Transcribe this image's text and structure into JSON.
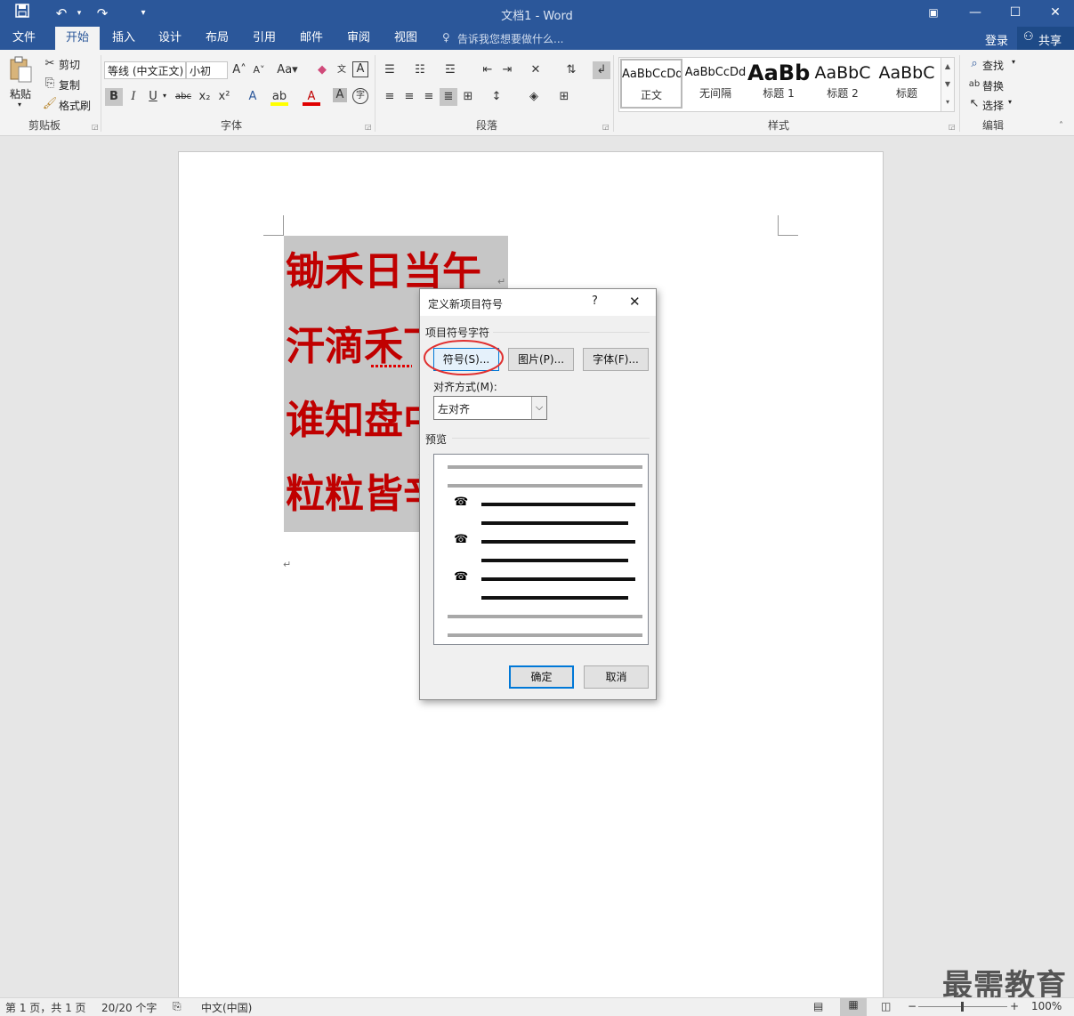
{
  "window": {
    "title": "文档1 - Word"
  },
  "tabs": [
    {
      "label": "文件"
    },
    {
      "label": "开始"
    },
    {
      "label": "插入"
    },
    {
      "label": "设计"
    },
    {
      "label": "布局"
    },
    {
      "label": "引用"
    },
    {
      "label": "邮件"
    },
    {
      "label": "审阅"
    },
    {
      "label": "视图"
    }
  ],
  "tell_me": "告诉我您想要做什么...",
  "account": {
    "login": "登录",
    "share": "共享"
  },
  "clipboard": {
    "paste": "粘贴",
    "cut": "剪切",
    "copy": "复制",
    "format_painter": "格式刷",
    "label": "剪贴板"
  },
  "font": {
    "name": "等线 (中文正文)",
    "size": "小初",
    "label": "字体"
  },
  "paragraph": {
    "label": "段落"
  },
  "styles": {
    "label": "样式",
    "items": [
      {
        "sample": "AaBbCcDd",
        "name": "正文"
      },
      {
        "sample": "AaBbCcDd",
        "name": "无间隔"
      },
      {
        "sample": "AaBb",
        "name": "标题 1"
      },
      {
        "sample": "AaBbC",
        "name": "标题 2"
      },
      {
        "sample": "AaBbC",
        "name": "标题"
      }
    ]
  },
  "editing": {
    "find": "查找",
    "replace": "替换",
    "select": "选择",
    "label": "编辑"
  },
  "document": {
    "lines": [
      "锄禾日当午",
      "汗滴禾下",
      "谁知盘中",
      "粒粒皆辛"
    ]
  },
  "dialog": {
    "title": "定义新项目符号",
    "help": "?",
    "group_label": "项目符号字符",
    "symbol_btn": "符号(S)...",
    "picture_btn": "图片(P)...",
    "font_btn": "字体(F)...",
    "align_label": "对齐方式(M):",
    "align_value": "左对齐",
    "preview_label": "预览",
    "bullet_glyph": "☎",
    "ok": "确定",
    "cancel": "取消"
  },
  "status": {
    "page": "第 1 页，共 1 页",
    "words": "20/20 个字",
    "lang": "中文(中国)",
    "zoom": "100%"
  },
  "watermark": "最需教育",
  "colors": {
    "accent": "#2b579a",
    "poem": "#c00000",
    "highlight_circle": "#e03030"
  }
}
